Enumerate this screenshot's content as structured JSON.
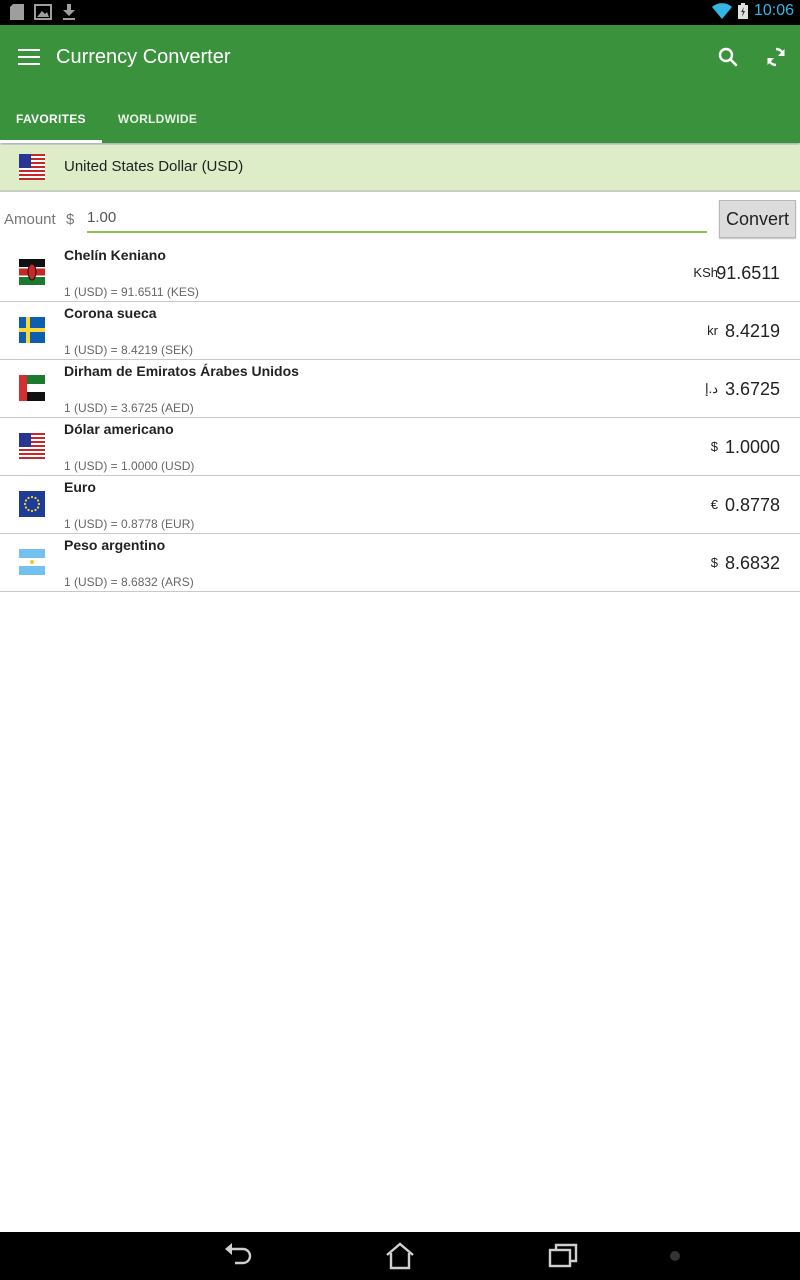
{
  "status_bar": {
    "time": "10:06"
  },
  "app_bar": {
    "title": "Currency Converter"
  },
  "tabs": [
    {
      "label": "FAVORITES",
      "active": true
    },
    {
      "label": "WORLDWIDE",
      "active": false
    }
  ],
  "base_currency": {
    "label": "United States Dollar (USD)",
    "flag": "us-flag-icon"
  },
  "amount": {
    "label": "Amount",
    "symbol": "$",
    "value": "1.00",
    "convert_label": "Convert"
  },
  "currencies": [
    {
      "name": "Chelín Keniano",
      "rate": "1 (USD) = 91.6511 (KES)",
      "symbol": "KSh",
      "value": "91.6511",
      "flag": "kenya-flag-icon"
    },
    {
      "name": "Corona sueca",
      "rate": "1 (USD) = 8.4219 (SEK)",
      "symbol": "kr",
      "value": "8.4219",
      "flag": "sweden-flag-icon"
    },
    {
      "name": "Dirham de Emiratos Árabes Unidos",
      "rate": "1 (USD) = 3.6725 (AED)",
      "symbol": "د.إ",
      "value": "3.6725",
      "flag": "uae-flag-icon"
    },
    {
      "name": "Dólar americano",
      "rate": "1 (USD) = 1.0000 (USD)",
      "symbol": "$",
      "value": "1.0000",
      "flag": "us-flag-icon"
    },
    {
      "name": "Euro",
      "rate": "1 (USD) = 0.8778 (EUR)",
      "symbol": "€",
      "value": "0.8778",
      "flag": "eu-flag-icon"
    },
    {
      "name": "Peso argentino",
      "rate": "1 (USD) = 8.6832 (ARS)",
      "symbol": "$",
      "value": "8.6832",
      "flag": "argentina-flag-icon"
    }
  ],
  "colors": {
    "primary": "#3b923d",
    "base_row": "#dcedc8",
    "accent": "#8bc34a"
  }
}
